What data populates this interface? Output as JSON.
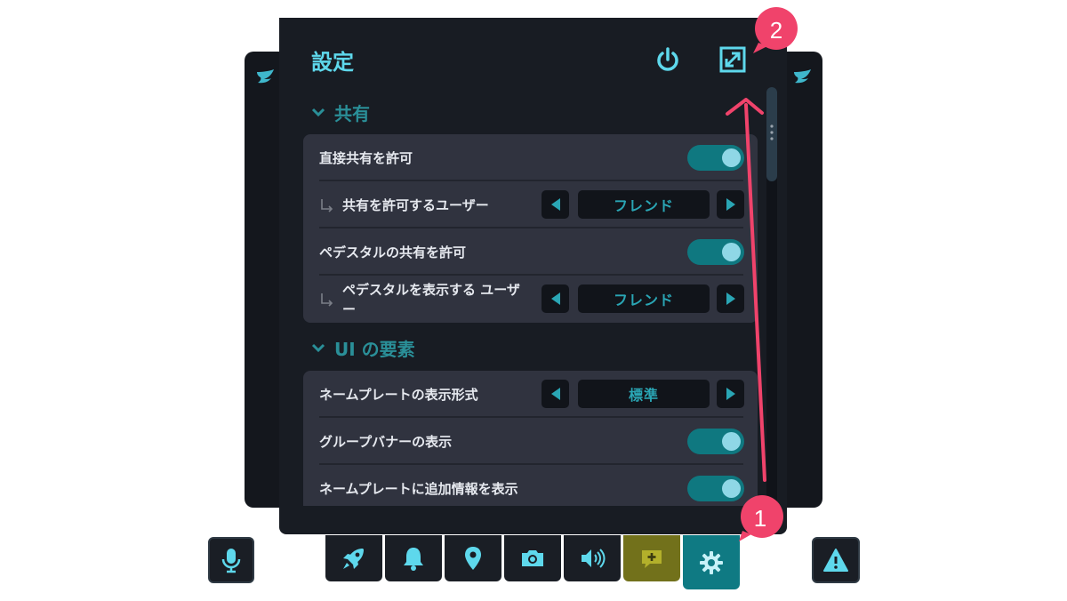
{
  "window": {
    "title": "設定",
    "power_icon": "power-icon",
    "expand_icon": "expand-icon"
  },
  "sections": [
    {
      "title": "共有",
      "rows": [
        {
          "label": "直接共有を許可",
          "control": "toggle",
          "value": true
        },
        {
          "label": "共有を許可するユーザー",
          "control": "stepper",
          "value": "フレンド",
          "sub": true
        },
        {
          "label": "ペデスタルの共有を許可",
          "control": "toggle",
          "value": true
        },
        {
          "label": "ペデスタルを表示する ユーザー",
          "control": "stepper",
          "value": "フレンド",
          "sub": true
        }
      ]
    },
    {
      "title": "UI の要素",
      "rows": [
        {
          "label": "ネームプレートの表示形式",
          "control": "stepper",
          "value": "標準"
        },
        {
          "label": "グループバナーの表示",
          "control": "toggle",
          "value": true
        },
        {
          "label": "ネームプレートに追加情報を表示",
          "control": "toggle",
          "value": true
        }
      ]
    }
  ],
  "toolbar": {
    "items": [
      {
        "icon": "rocket-icon"
      },
      {
        "icon": "bell-icon"
      },
      {
        "icon": "location-pin-icon"
      },
      {
        "icon": "camera-icon"
      },
      {
        "icon": "speaker-icon"
      },
      {
        "icon": "chat-plus-icon"
      },
      {
        "icon": "gear-icon"
      }
    ],
    "mic_icon": "microphone-icon",
    "warning_icon": "warning-icon"
  },
  "annotations": {
    "badge1": "1",
    "badge2": "2",
    "color": "#f0436b"
  },
  "colors": {
    "accent": "#5ed8ec",
    "toggle_on": "#0f7880",
    "settings_active": "#0f7a83",
    "chat_button": "#72711b"
  }
}
